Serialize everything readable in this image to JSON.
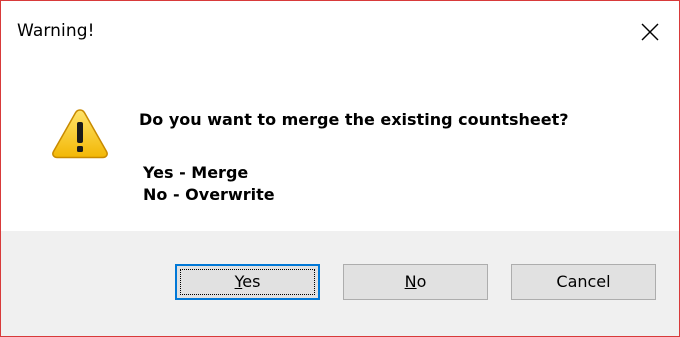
{
  "window": {
    "title": "Warning!"
  },
  "message": {
    "question": "Do you want to merge the existing countsheet?",
    "option_yes": "Yes - Merge",
    "option_no": "No - Overwrite"
  },
  "buttons": {
    "yes_mnemonic": "Y",
    "yes_rest": "es",
    "no_mnemonic": "N",
    "no_rest": "o",
    "cancel_label": "Cancel"
  },
  "icons": {
    "warning": "warning-triangle-icon",
    "close": "close-icon"
  },
  "colors": {
    "window_border": "#d83a3a",
    "button_bar": "#f0f0f0",
    "focus_border": "#0078d7",
    "warning_yellow": "#f5c518"
  }
}
